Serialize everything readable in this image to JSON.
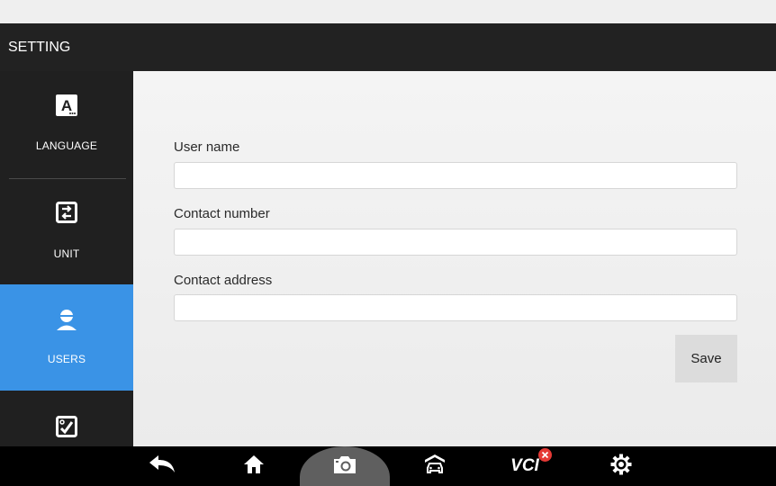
{
  "header": {
    "title": "SETTING"
  },
  "sidebar": {
    "items": [
      {
        "label": "LANGUAGE",
        "icon": "language-icon",
        "active": false
      },
      {
        "label": "UNIT",
        "icon": "unit-icon",
        "active": false
      },
      {
        "label": "USERS",
        "icon": "user-icon",
        "active": true
      },
      {
        "label": "",
        "icon": "checkbox-icon",
        "active": false
      }
    ]
  },
  "form": {
    "user_name": {
      "label": "User name",
      "value": ""
    },
    "contact_number": {
      "label": "Contact number",
      "value": ""
    },
    "contact_address": {
      "label": "Contact address",
      "value": ""
    },
    "save_label": "Save"
  },
  "taskbar": {
    "icons": [
      "back-icon",
      "home-icon",
      "camera-icon",
      "car-icon",
      "vci-icon",
      "settings-icon"
    ],
    "vci_label": "VCI",
    "vci_status": "disconnected"
  },
  "colors": {
    "header_bg": "#222222",
    "sidebar_bg": "#202020",
    "active_bg": "#3a93e6",
    "content_bg": "#f1f1f1",
    "taskbar_bg": "#000000",
    "error_badge": "#e53935"
  }
}
